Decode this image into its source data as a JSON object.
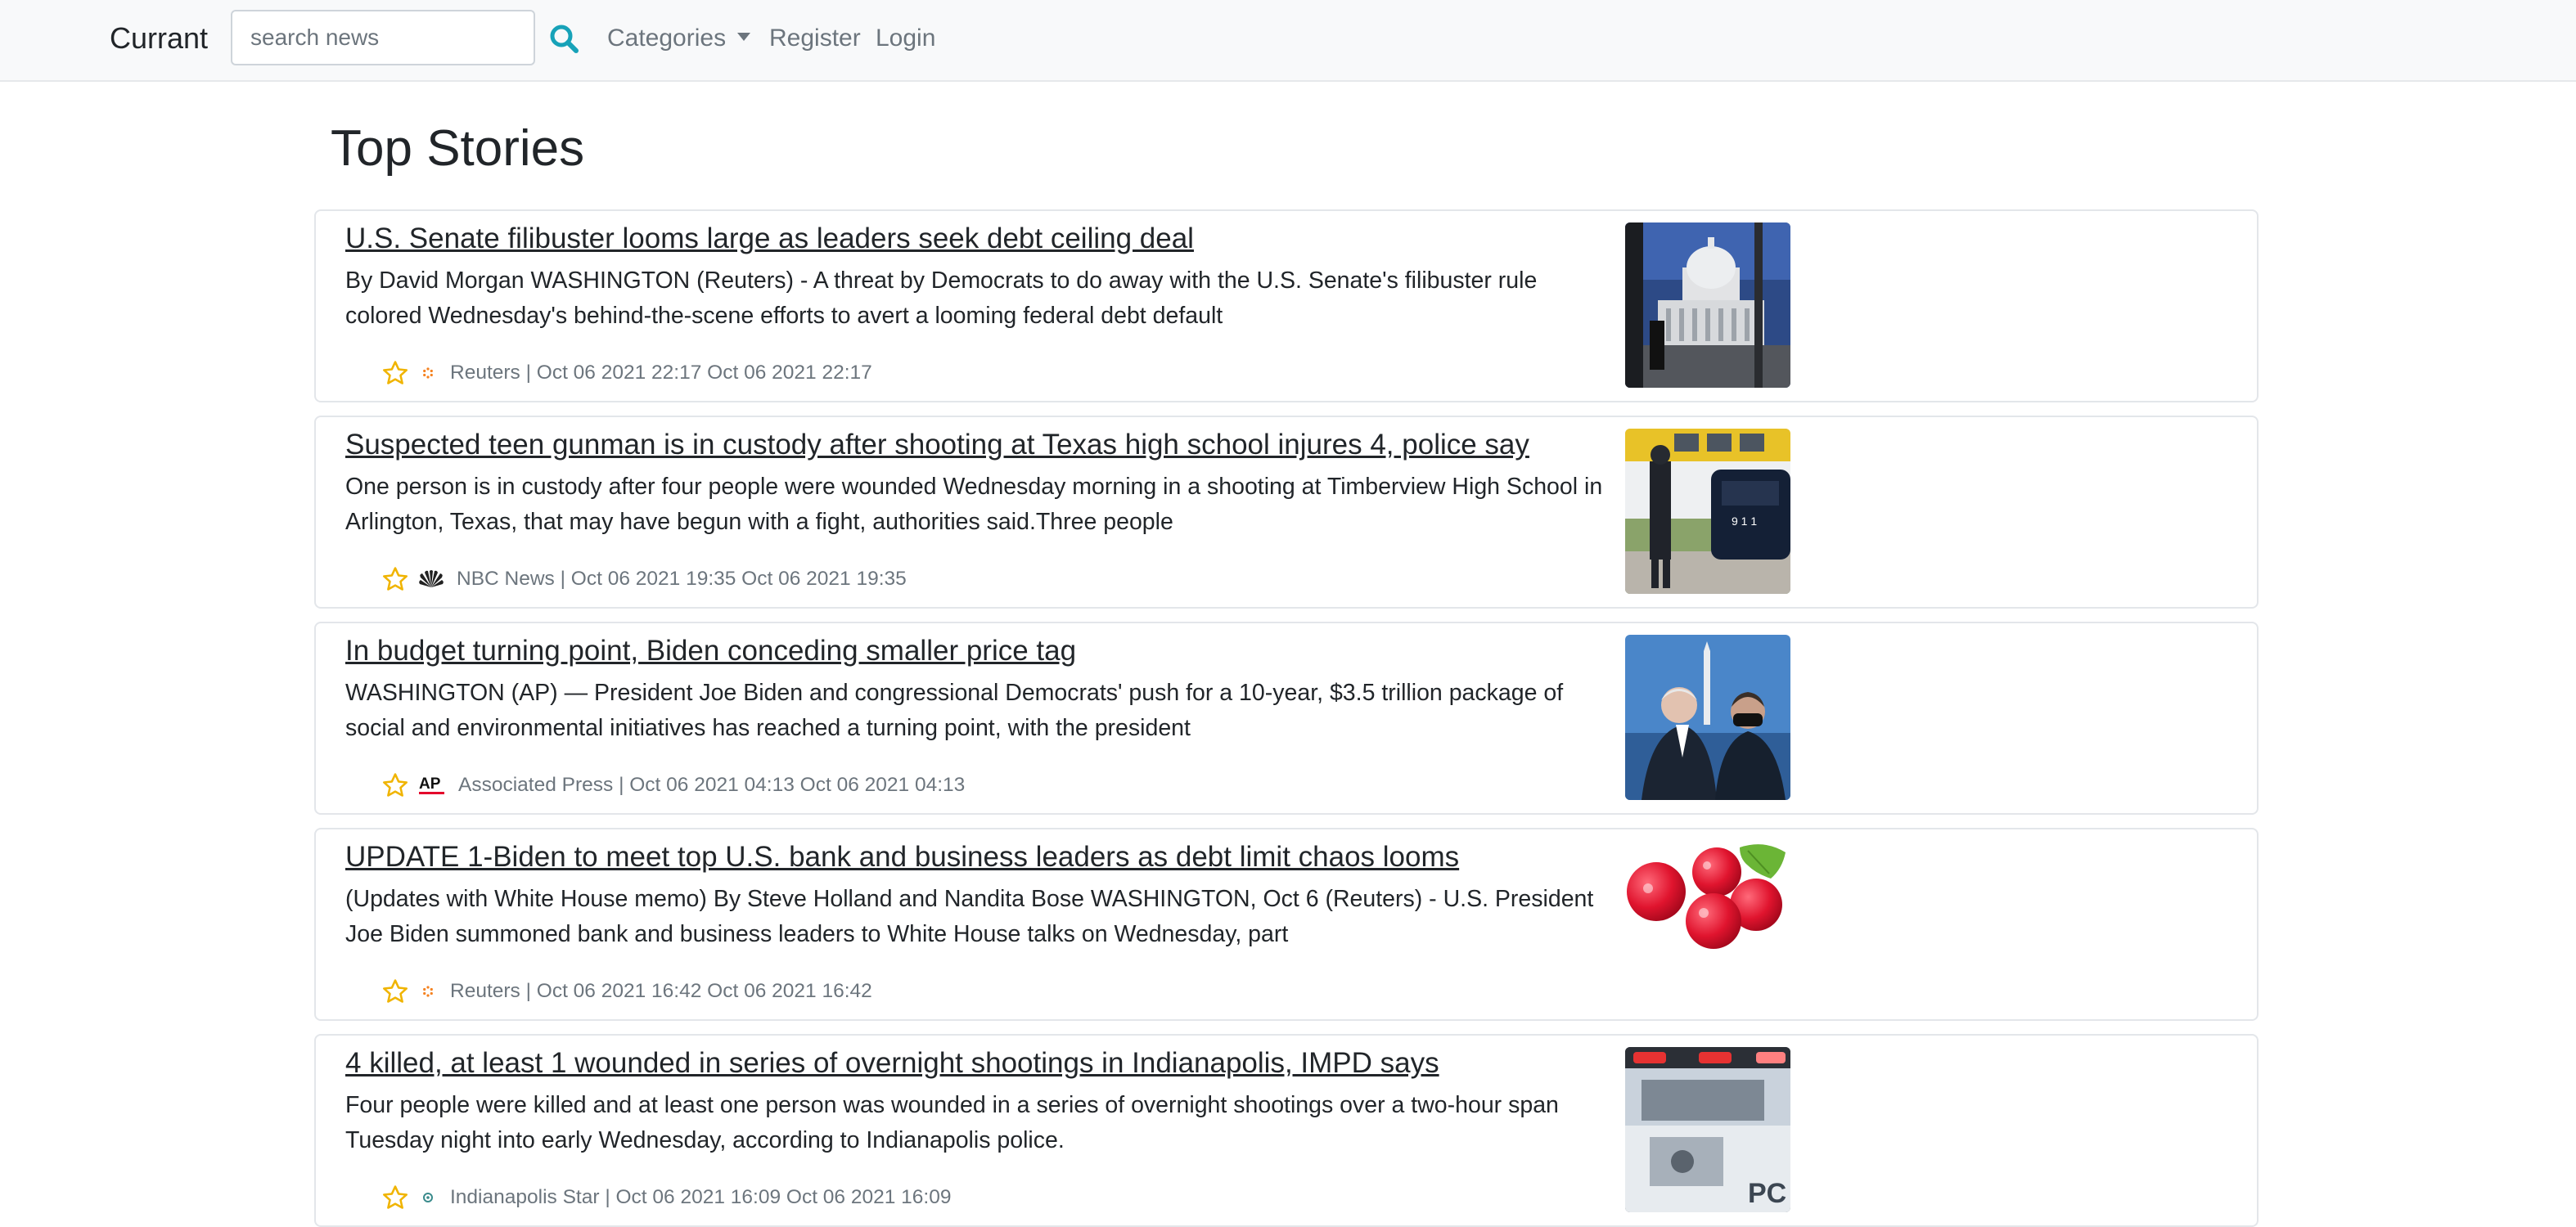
{
  "navbar": {
    "brand": "Currant",
    "search_placeholder": "search news",
    "categories_label": "Categories",
    "register_label": "Register",
    "login_label": "Login"
  },
  "page_title": "Top Stories",
  "colors": {
    "star": "#f0b400",
    "reuters": "#f58220",
    "ap_red": "#e4002b",
    "muted": "#6c757d"
  },
  "stories": [
    {
      "title": "U.S. Senate filibuster looms large as leaders seek debt ceiling deal",
      "description": "By David Morgan WASHINGTON (Reuters) - A threat by Democrats to do away with the U.S. Senate's filibuster rule colored Wednesday's behind-the-scene efforts to avert a looming federal debt default",
      "source_icon": "reuters-icon",
      "meta": "Reuters | Oct 06 2021 22:17 Oct 06 2021 22:17",
      "image": "capitol-building-thumbnail"
    },
    {
      "title": "Suspected teen gunman is in custody after shooting at Texas high school injures 4, police say",
      "description": "One person is in custody after four people were wounded Wednesday morning in a shooting at Timberview High School in Arlington, Texas, that may have begun with a fight, authorities said.Three people",
      "source_icon": "nbc-peacock-icon",
      "meta": "NBC News | Oct 06 2021 19:35 Oct 06 2021 19:35",
      "image": "school-bus-police-thumbnail"
    },
    {
      "title": "In budget turning point, Biden conceding smaller price tag",
      "description": "WASHINGTON (AP) — President Joe Biden and congressional Democrats' push for a 10-year, $3.5 trillion package of social and environmental initiatives has reached a turning point, with the president",
      "source_icon": "ap-icon",
      "source_icon_text": "AP",
      "meta": "Associated Press | Oct 06 2021 04:13 Oct 06 2021 04:13",
      "image": "biden-thumbnail"
    },
    {
      "title": "UPDATE 1-Biden to meet top U.S. bank and business leaders as debt limit chaos looms",
      "description": "(Updates with White House memo) By Steve Holland and Nandita Bose WASHINGTON, Oct 6 (Reuters) - U.S. President Joe Biden summoned bank and business leaders to White House talks on Wednesday, part",
      "source_icon": "reuters-icon",
      "meta": "Reuters | Oct 06 2021 16:42 Oct 06 2021 16:42",
      "image": "currants-thumbnail"
    },
    {
      "title": "4 killed, at least 1 wounded in series of overnight shootings in Indianapolis, IMPD says",
      "description": "Four people were killed and at least one person was wounded in a series of overnight shootings over a two-hour span Tuesday night into early Wednesday, according to Indianapolis police.",
      "source_icon": "indystar-icon",
      "meta": "Indianapolis Star | Oct 06 2021 16:09 Oct 06 2021 16:09",
      "image": "police-car-thumbnail"
    }
  ]
}
